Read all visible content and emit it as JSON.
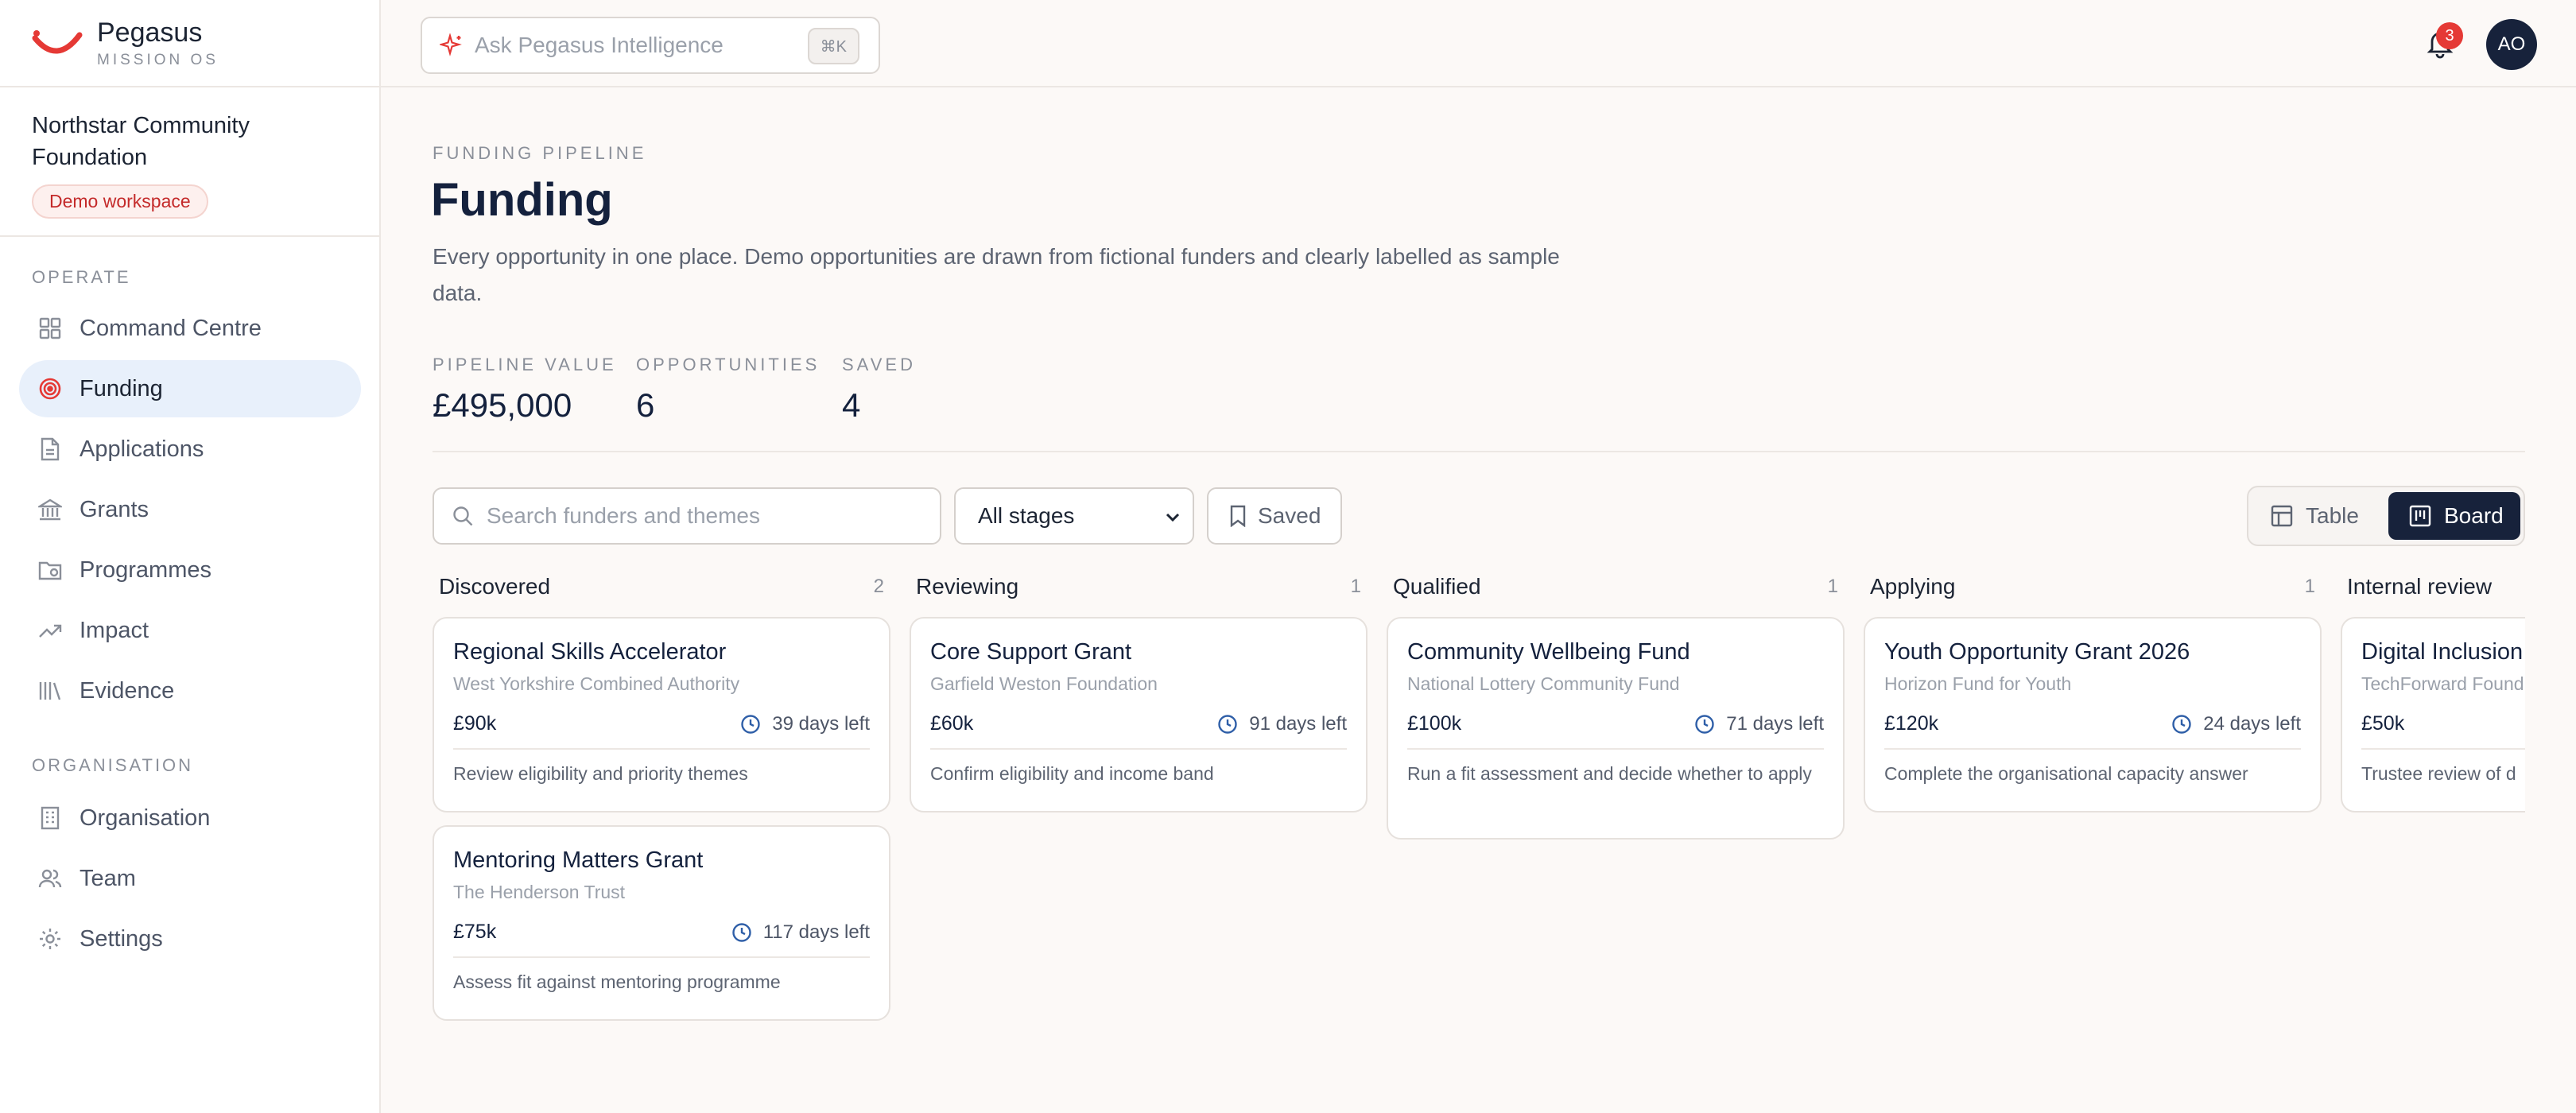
{
  "app": {
    "name": "Pegasus",
    "tagline": "MISSION OS"
  },
  "org": {
    "name": "Northstar Community Foundation",
    "badge": "Demo workspace"
  },
  "sidebar": {
    "operate_label": "OPERATE",
    "organisation_label": "ORGANISATION",
    "items": [
      {
        "label": "Command Centre",
        "icon": "grid-icon"
      },
      {
        "label": "Funding",
        "icon": "target-icon"
      },
      {
        "label": "Applications",
        "icon": "document-icon"
      },
      {
        "label": "Grants",
        "icon": "bank-icon"
      },
      {
        "label": "Programmes",
        "icon": "folder-icon"
      },
      {
        "label": "Impact",
        "icon": "trend-icon"
      },
      {
        "label": "Evidence",
        "icon": "library-icon"
      },
      {
        "label": "Organisation",
        "icon": "building-icon"
      },
      {
        "label": "Team",
        "icon": "users-icon"
      },
      {
        "label": "Settings",
        "icon": "gear-icon"
      }
    ],
    "active": "Funding"
  },
  "topbar": {
    "ask_placeholder": "Ask Pegasus Intelligence",
    "shortcut": "⌘K",
    "notifications": "3",
    "avatar_initials": "AO"
  },
  "page": {
    "eyebrow": "FUNDING PIPELINE",
    "title": "Funding",
    "description": "Every opportunity in one place. Demo opportunities are drawn from fictional funders and clearly labelled as sample data."
  },
  "stats": [
    {
      "label": "PIPELINE VALUE",
      "value": "£495,000"
    },
    {
      "label": "OPPORTUNITIES",
      "value": "6"
    },
    {
      "label": "SAVED",
      "value": "4"
    }
  ],
  "filters": {
    "search_placeholder": "Search funders and themes",
    "stage_selected": "All stages",
    "saved_label": "Saved"
  },
  "view_toggle": {
    "table": "Table",
    "board": "Board",
    "selected": "Board"
  },
  "colors": {
    "accent": "#e53935",
    "navy": "#17223b",
    "active_bg": "#e8f0fb"
  },
  "columns": [
    {
      "name": "Discovered",
      "count": "2",
      "cards": [
        {
          "title": "Regional Skills Accelerator",
          "funder": "West Yorkshire Combined Authority",
          "amount": "£90k",
          "days": "39 days left",
          "note": "Review eligibility and priority themes"
        },
        {
          "title": "Mentoring Matters Grant",
          "funder": "The Henderson Trust",
          "amount": "£75k",
          "days": "117 days left",
          "note": "Assess fit against mentoring programme"
        }
      ]
    },
    {
      "name": "Reviewing",
      "count": "1",
      "cards": [
        {
          "title": "Core Support Grant",
          "funder": "Garfield Weston Foundation",
          "amount": "£60k",
          "days": "91 days left",
          "note": "Confirm eligibility and income band"
        }
      ]
    },
    {
      "name": "Qualified",
      "count": "1",
      "cards": [
        {
          "title": "Community Wellbeing Fund",
          "funder": "National Lottery Community Fund",
          "amount": "£100k",
          "days": "71 days left",
          "note": "Run a fit assessment and decide whether to apply"
        }
      ]
    },
    {
      "name": "Applying",
      "count": "1",
      "cards": [
        {
          "title": "Youth Opportunity Grant 2026",
          "funder": "Horizon Fund for Youth",
          "amount": "£120k",
          "days": "24 days left",
          "note": "Complete the organisational capacity answer"
        }
      ]
    },
    {
      "name": "Internal review",
      "count": "",
      "cards": [
        {
          "title": "Digital Inclusion",
          "funder": "TechForward Found",
          "amount": "£50k",
          "days": "",
          "note": "Trustee review of d"
        }
      ]
    }
  ]
}
